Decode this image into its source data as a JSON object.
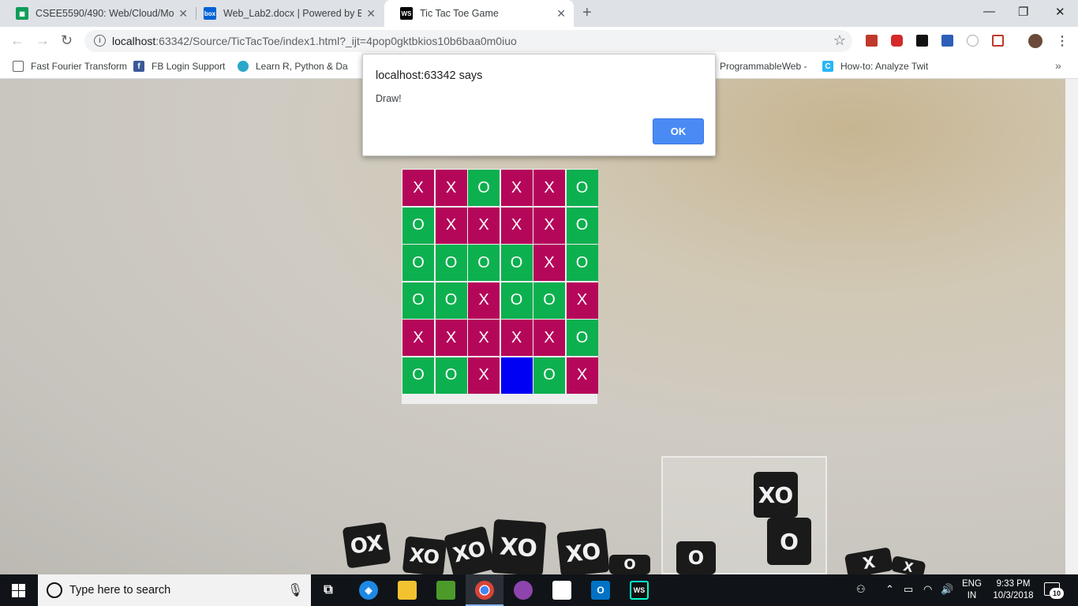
{
  "browser": {
    "tabs": [
      {
        "title": "CSEE5590/490: Web/Cloud/Mobi",
        "icon": "sheets-icon",
        "color": "#0f9d58"
      },
      {
        "title": "Web_Lab2.docx | Powered by Bo",
        "icon": "box-icon",
        "color": "#0061d5"
      },
      {
        "title": "Tic Tac Toe Game",
        "icon": "webstorm-icon",
        "color": "#000000"
      }
    ],
    "new_tab": "+",
    "url_host": "localhost",
    "url_path": ":63342/Source/TicTacToe/index1.html?_ijt=4pop0gktbkios10b6baa0m0iuo",
    "bookmarks": [
      {
        "label": "Fast Fourier Transform",
        "icon": "page-icon"
      },
      {
        "label": "FB Login Support",
        "icon": "facebook-icon"
      },
      {
        "label": "Learn R, Python & Da",
        "icon": "shield-icon"
      },
      {
        "label": "ProgrammableWeb -",
        "icon": "programmableweb-icon"
      },
      {
        "label": "How-to: Analyze Twit",
        "icon": "c-icon"
      }
    ]
  },
  "dialog": {
    "title": "localhost:63342 says",
    "message": "Draw!",
    "ok_label": "OK"
  },
  "board": {
    "rows": [
      [
        "X",
        "X",
        "O",
        "X",
        "X",
        "O"
      ],
      [
        "O",
        "X",
        "X",
        "X",
        "X",
        "O"
      ],
      [
        "O",
        "O",
        "O",
        "O",
        "X",
        "O"
      ],
      [
        "O",
        "O",
        "X",
        "O",
        "O",
        "X"
      ],
      [
        "X",
        "X",
        "X",
        "X",
        "X",
        "O"
      ],
      [
        "O",
        "O",
        "X",
        "",
        "O",
        "X"
      ]
    ],
    "colors": {
      "x": "#b5075a",
      "o": "#0db04f",
      "empty": "#0000f5"
    }
  },
  "taskbar": {
    "search_placeholder": "Type here to search",
    "lang_line1": "ENG",
    "lang_line2": "IN",
    "time": "9:33 PM",
    "date": "10/3/2018",
    "notification_count": "10"
  }
}
